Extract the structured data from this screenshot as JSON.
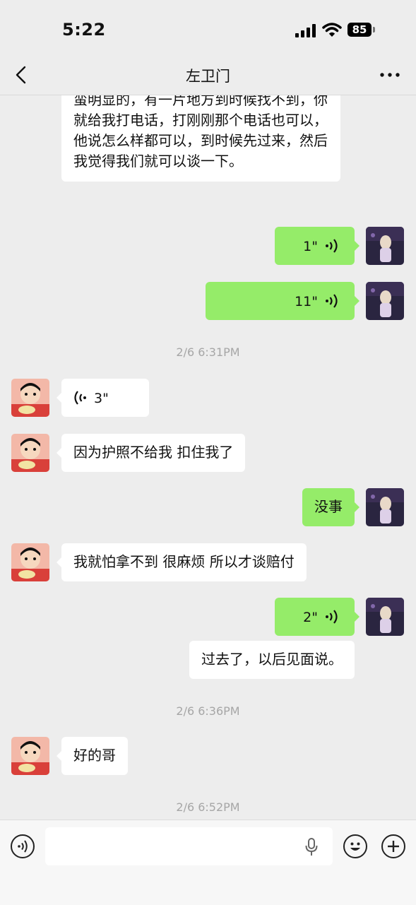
{
  "status_bar": {
    "time": "5:22",
    "battery": "85"
  },
  "nav": {
    "title": "左卫门"
  },
  "messages": {
    "m0": {
      "text": "蛮明显的，有一片地方到时候找不到，你就给我打电话，打刚刚那个电话也可以，他说怎么样都可以，到时候先过来，然后我觉得我们就可以谈一下。"
    },
    "m1": {
      "duration": "1\""
    },
    "m2": {
      "duration": "11\""
    },
    "ts1": "2/6 6:31PM",
    "m3": {
      "duration": "3\""
    },
    "m4": {
      "text": "因为护照不给我 扣住我了"
    },
    "m5": {
      "text": "没事"
    },
    "m6": {
      "text": "我就怕拿不到 很麻烦 所以才谈赔付"
    },
    "m7": {
      "duration": "2\""
    },
    "m8": {
      "text": "过去了，以后见面说。"
    },
    "ts2": "2/6 6:36PM",
    "m9": {
      "text": "好的哥"
    },
    "ts3": "2/6 6:52PM"
  },
  "input": {
    "placeholder": ""
  },
  "icons": {
    "back": "chevron-left-icon",
    "more": "more-icon",
    "voice_mode": "voice-mode-icon",
    "mic": "microphone-icon",
    "emoji": "emoji-icon",
    "plus": "plus-icon"
  },
  "colors": {
    "outgoing_bubble": "#95ec69",
    "incoming_bubble": "#ffffff",
    "background": "#ededed"
  }
}
